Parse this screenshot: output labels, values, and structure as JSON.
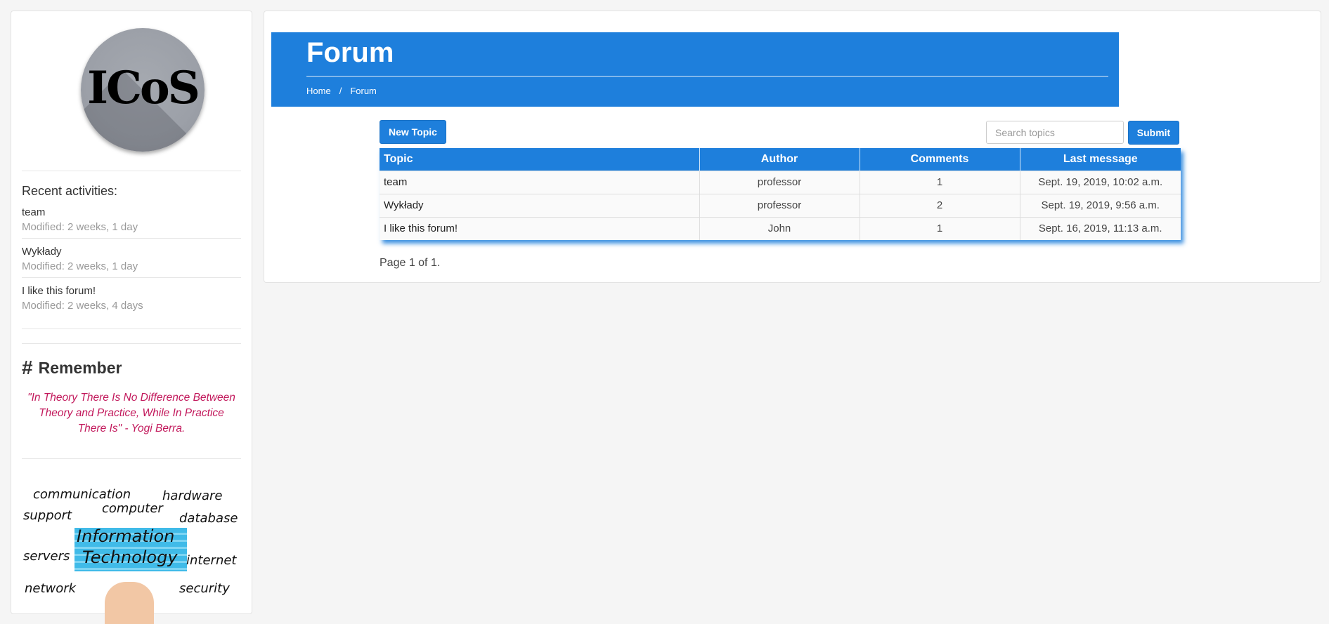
{
  "sidebar": {
    "logo_text": "ICoS",
    "recent_title": "Recent activities:",
    "recent": [
      {
        "name": "team",
        "meta": "Modified: 2 weeks, 1 day"
      },
      {
        "name": "Wykłady",
        "meta": "Modified: 2 weeks, 1 day"
      },
      {
        "name": "I like this forum!",
        "meta": "Modified: 2 weeks, 4 days"
      }
    ],
    "remember_symbol": "#",
    "remember_title": "Remember",
    "quote": "\"In Theory There Is No Difference Between Theory and Practice, While In Practice There Is\" - Yogi Berra.",
    "it_image": {
      "title_line1": "Information",
      "title_line2": "Technology",
      "words": [
        "communication",
        "hardware",
        "support",
        "computer",
        "database",
        "servers",
        "internet",
        "network",
        "security"
      ]
    }
  },
  "header": {
    "title": "Forum",
    "breadcrumb": [
      "Home",
      "/",
      "Forum"
    ]
  },
  "toolbar": {
    "new_topic_label": "New Topic",
    "search_placeholder": "Search topics",
    "submit_label": "Submit"
  },
  "table": {
    "columns": [
      "Topic",
      "Author",
      "Comments",
      "Last message"
    ],
    "rows": [
      [
        "team",
        "professor",
        "1",
        "Sept. 19, 2019, 10:02 a.m."
      ],
      [
        "Wykłady",
        "professor",
        "2",
        "Sept. 19, 2019, 9:56 a.m."
      ],
      [
        "I like this forum!",
        "John",
        "1",
        "Sept. 16, 2019, 11:13 a.m."
      ]
    ]
  },
  "pagination": "Page 1 of 1.",
  "colors": {
    "accent": "#1e7fdc",
    "quote": "#c2185b",
    "background": "#f5f5f5"
  }
}
